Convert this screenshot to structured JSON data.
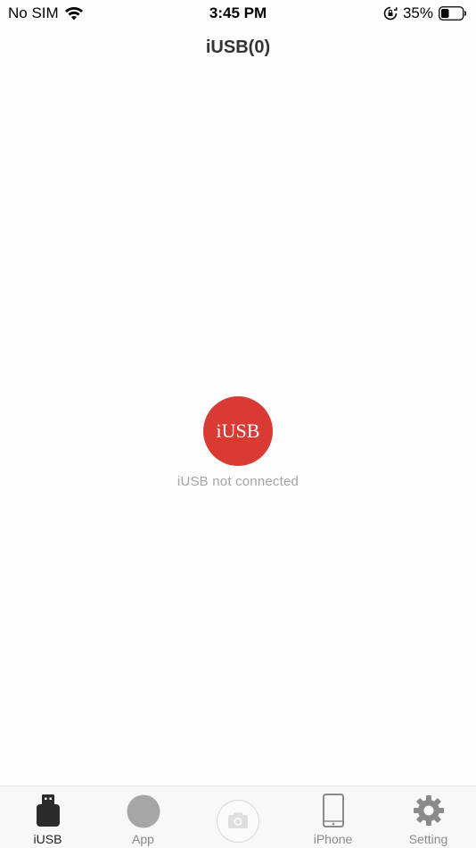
{
  "status_bar": {
    "carrier": "No SIM",
    "time": "3:45 PM",
    "battery": "35%",
    "icons": [
      "wifi-icon",
      "orientation-lock-icon",
      "battery-icon"
    ]
  },
  "nav": {
    "title": "iUSB(0)"
  },
  "main": {
    "badge_text": "iUSB",
    "badge_color": "#d93a33",
    "status_text": "iUSB not connected"
  },
  "tab_bar": {
    "tabs": [
      {
        "label": "iUSB",
        "icon": "usb-drive-icon",
        "active": true
      },
      {
        "label": "App",
        "icon": "app-circle-icon",
        "active": false
      },
      {
        "label": "",
        "icon": "camera-icon",
        "active": false
      },
      {
        "label": "iPhone",
        "icon": "iphone-icon",
        "active": false
      },
      {
        "label": "Setting",
        "icon": "gear-icon",
        "active": false
      }
    ]
  }
}
